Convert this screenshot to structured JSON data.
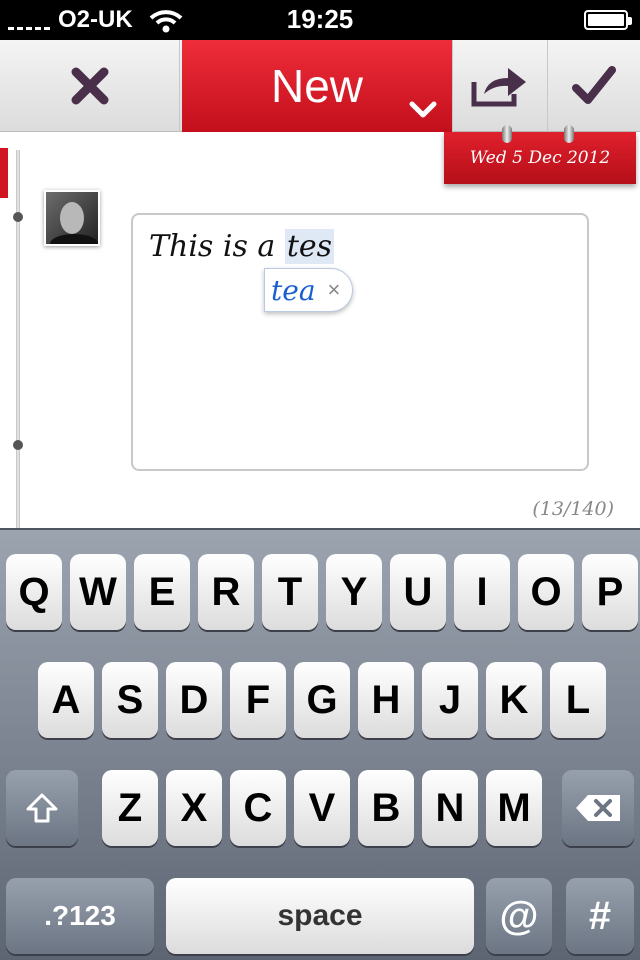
{
  "status_bar": {
    "carrier": "O2-UK",
    "time": "19:25"
  },
  "toolbar": {
    "title": "New"
  },
  "date": "Wed 5 Dec 2012",
  "compose": {
    "text_before": "This is a ",
    "current_word": "tes",
    "suggestion": "tea",
    "dismiss": "×",
    "char_count": "(13/140)"
  },
  "keyboard": {
    "row1": [
      "Q",
      "W",
      "E",
      "R",
      "T",
      "Y",
      "U",
      "I",
      "O",
      "P"
    ],
    "row2": [
      "A",
      "S",
      "D",
      "F",
      "G",
      "H",
      "J",
      "K",
      "L"
    ],
    "row3": [
      "Z",
      "X",
      "C",
      "V",
      "B",
      "N",
      "M"
    ],
    "numbers_label": ".?123",
    "space_label": "space",
    "at_label": "@",
    "hash_label": "#"
  },
  "colors": {
    "accent": "#d7131f",
    "icon": "#4a2f4a",
    "link": "#1a5fd0"
  }
}
